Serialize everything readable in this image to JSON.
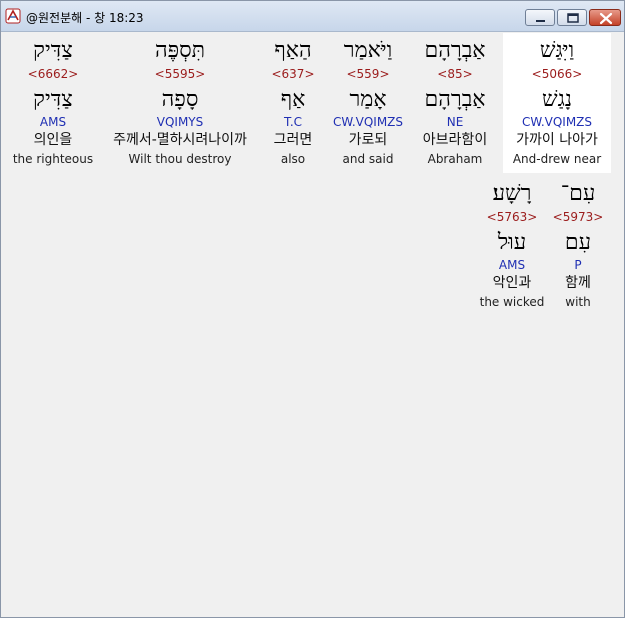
{
  "window": {
    "title": "@원전분해 - 창 18:23"
  },
  "words": [
    {
      "heb1": "וַיִּגַּשׁ",
      "strong": "<5066>",
      "heb2": "נָגַשׁ",
      "morph": "CW.VQIMZS",
      "kor": "가까이 나아가",
      "eng": "And-drew near",
      "selected": true
    },
    {
      "heb1": "אַבְרָהָם",
      "strong": "<85>",
      "heb2": "אַבְרָהָם",
      "morph": "NE",
      "kor": "아브라함이",
      "eng": "Abraham"
    },
    {
      "heb1": "וַיֹּאמַר",
      "strong": "<559>",
      "heb2": "אָמַר",
      "morph": "CW.VQIMZS",
      "kor": "가로되",
      "eng": "and said"
    },
    {
      "heb1": "הַאַף",
      "strong": "<637>",
      "heb2": "אַף",
      "morph": "T.C",
      "kor": "그러면",
      "eng": "also"
    },
    {
      "heb1": "תִּסְפֶּה",
      "strong": "<5595>",
      "heb2": "סָפָה",
      "morph": "VQIMYS",
      "kor": "주께서-멸하시려나이까",
      "eng": "Wilt thou destroy"
    },
    {
      "heb1": "צַדִּיק",
      "strong": "<6662>",
      "heb2": "צַדִּיק",
      "morph": "AMS",
      "kor": "의인을",
      "eng": "the righteous"
    },
    {
      "heb1": "עִם־",
      "strong": "<5973>",
      "heb2": "עִם",
      "morph": "P",
      "kor": "함께",
      "eng": "with"
    },
    {
      "heb1": "רָשָׁע׃",
      "strong": "<5763>",
      "heb2": "עוּל",
      "morph": "AMS",
      "kor": "악인과",
      "eng": "the wicked"
    }
  ]
}
